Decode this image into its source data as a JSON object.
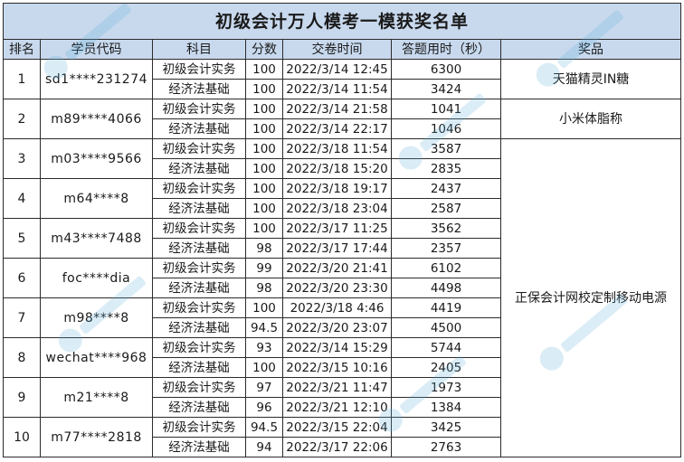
{
  "title": "初级会计万人模考一模获奖名单",
  "headers": {
    "rank": "排名",
    "code": "学员代码",
    "subject": "科目",
    "score": "分数",
    "submit_time": "交卷时间",
    "duration": "答题用时（秒）",
    "prize": "奖品"
  },
  "winners": [
    {
      "rank": "1",
      "code": "sd1****231274",
      "rows": [
        {
          "subject": "初级会计实务",
          "score": "100",
          "time": "2022/3/14 12:45",
          "duration": "6300"
        },
        {
          "subject": "经济法基础",
          "score": "100",
          "time": "2022/3/14 11:54",
          "duration": "3424"
        }
      ]
    },
    {
      "rank": "2",
      "code": "m89****4066",
      "rows": [
        {
          "subject": "初级会计实务",
          "score": "100",
          "time": "2022/3/14 21:58",
          "duration": "1041"
        },
        {
          "subject": "经济法基础",
          "score": "100",
          "time": "2022/3/14 22:17",
          "duration": "1046"
        }
      ]
    },
    {
      "rank": "3",
      "code": "m03****9566",
      "rows": [
        {
          "subject": "初级会计实务",
          "score": "100",
          "time": "2022/3/18 11:54",
          "duration": "3587"
        },
        {
          "subject": "经济法基础",
          "score": "100",
          "time": "2022/3/18 15:20",
          "duration": "2835"
        }
      ]
    },
    {
      "rank": "4",
      "code": "m64****8",
      "rows": [
        {
          "subject": "初级会计实务",
          "score": "100",
          "time": "2022/3/18 19:17",
          "duration": "2437"
        },
        {
          "subject": "经济法基础",
          "score": "100",
          "time": "2022/3/18 23:04",
          "duration": "2587"
        }
      ]
    },
    {
      "rank": "5",
      "code": "m43****7488",
      "rows": [
        {
          "subject": "初级会计实务",
          "score": "100",
          "time": "2022/3/17 11:25",
          "duration": "3562"
        },
        {
          "subject": "经济法基础",
          "score": "98",
          "time": "2022/3/17 17:44",
          "duration": "2357"
        }
      ]
    },
    {
      "rank": "6",
      "code": "foc****dia",
      "rows": [
        {
          "subject": "初级会计实务",
          "score": "99",
          "time": "2022/3/20 21:41",
          "duration": "6102"
        },
        {
          "subject": "经济法基础",
          "score": "98",
          "time": "2022/3/20 23:30",
          "duration": "4498"
        }
      ]
    },
    {
      "rank": "7",
      "code": "m98****8",
      "rows": [
        {
          "subject": "初级会计实务",
          "score": "100",
          "time": "2022/3/18 4:46",
          "duration": "4419"
        },
        {
          "subject": "经济法基础",
          "score": "94.5",
          "time": "2022/3/20 23:07",
          "duration": "4500"
        }
      ]
    },
    {
      "rank": "8",
      "code": "wechat****968",
      "rows": [
        {
          "subject": "初级会计实务",
          "score": "93",
          "time": "2022/3/14 15:29",
          "duration": "5744"
        },
        {
          "subject": "经济法基础",
          "score": "100",
          "time": "2022/3/15 10:16",
          "duration": "2405"
        }
      ]
    },
    {
      "rank": "9",
      "code": "m21****8",
      "rows": [
        {
          "subject": "初级会计实务",
          "score": "97",
          "time": "2022/3/21 11:47",
          "duration": "1973"
        },
        {
          "subject": "经济法基础",
          "score": "96",
          "time": "2022/3/21 12:10",
          "duration": "1384"
        }
      ]
    },
    {
      "rank": "10",
      "code": "m77****2818",
      "rows": [
        {
          "subject": "初级会计实务",
          "score": "94.5",
          "time": "2022/3/15 22:04",
          "duration": "3425"
        },
        {
          "subject": "经济法基础",
          "score": "94",
          "time": "2022/3/17 22:06",
          "duration": "2763"
        }
      ]
    }
  ],
  "prizes": {
    "first": "天猫精灵IN糖",
    "second": "小米体脂称",
    "rest": "正保会计网校定制移动电源"
  }
}
